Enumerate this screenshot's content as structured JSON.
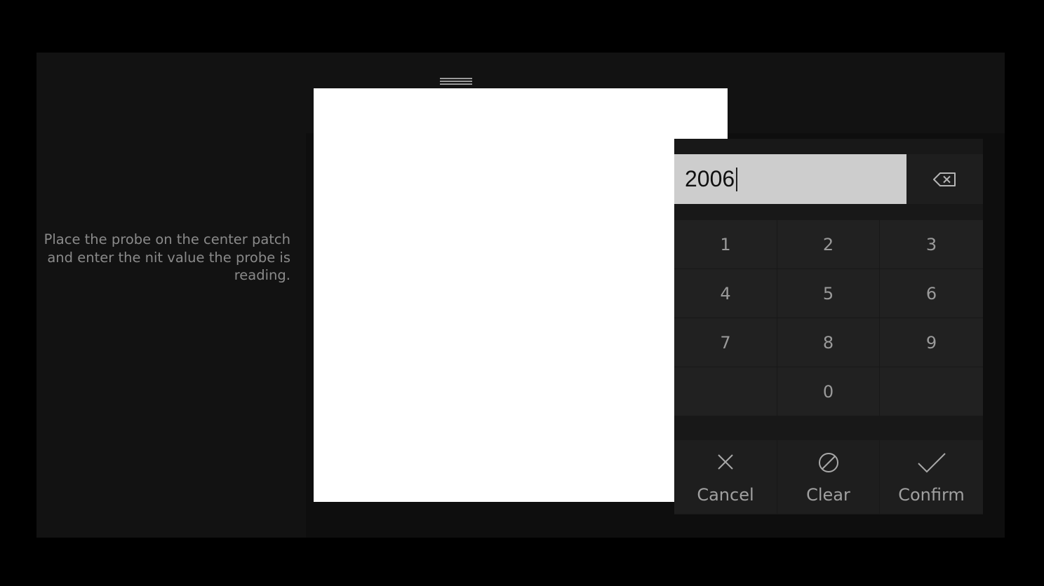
{
  "instructions": {
    "text": "Place the probe on the center patch and enter the nit value the probe is reading."
  },
  "keypad": {
    "display_value": "2006",
    "backspace_icon": "backspace-icon",
    "keys": {
      "k1": "1",
      "k2": "2",
      "k3": "3",
      "k4": "4",
      "k5": "5",
      "k6": "6",
      "k7": "7",
      "k8": "8",
      "k9": "9",
      "k0": "0"
    },
    "actions": {
      "cancel": {
        "label": "Cancel",
        "icon": "close-icon"
      },
      "clear": {
        "label": "Clear",
        "icon": "clear-icon"
      },
      "confirm": {
        "label": "Confirm",
        "icon": "check-icon"
      }
    }
  },
  "colors": {
    "background": "#000000",
    "panel": "#121212",
    "keypad": "#181818",
    "key": "#212121",
    "display": "#cdcdcd",
    "patch": "#ffffff",
    "text_muted": "#8a8a8a"
  }
}
